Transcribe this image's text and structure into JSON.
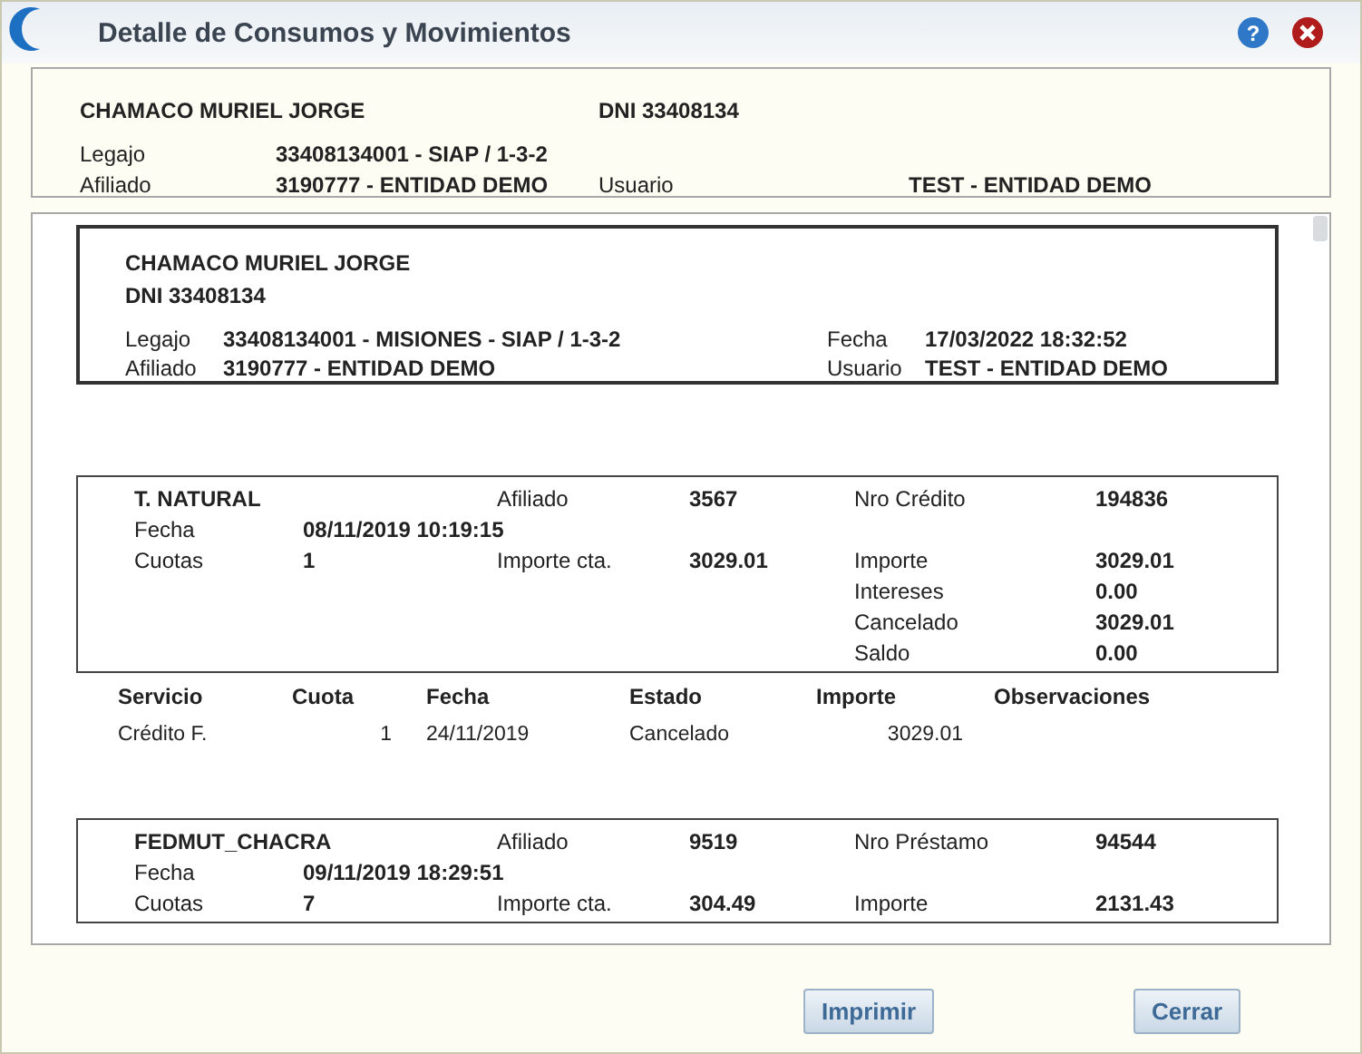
{
  "window": {
    "title": "Detalle de Consumos y Movimientos",
    "help": "?"
  },
  "header": {
    "name": "CHAMACO MURIEL JORGE",
    "dni": "DNI  33408134",
    "legajo": {
      "label": "Legajo",
      "value": "33408134001  -  SIAP / 1-3-2"
    },
    "afiliado": {
      "label": "Afiliado",
      "value": "3190777  -  ENTIDAD DEMO"
    },
    "usuario": {
      "label": "Usuario",
      "value": "TEST  -  ENTIDAD DEMO"
    }
  },
  "report": {
    "name": "CHAMACO MURIEL JORGE",
    "dni": "DNI  33408134",
    "legajo": {
      "label": "Legajo",
      "value": "33408134001  -  MISIONES - SIAP / 1-3-2"
    },
    "afiliado": {
      "label": "Afiliado",
      "value": "3190777  -  ENTIDAD DEMO"
    },
    "fecha": {
      "label": "Fecha",
      "value": "17/03/2022   18:32:52"
    },
    "usuario": {
      "label": "Usuario",
      "value": "TEST  -  ENTIDAD DEMO"
    }
  },
  "credits": [
    {
      "title": "T. NATURAL",
      "afiliado": {
        "label": "Afiliado",
        "value": "3567"
      },
      "number": {
        "label": "Nro Crédito",
        "value": "194836"
      },
      "fecha": {
        "label": "Fecha",
        "value": "08/11/2019   10:19:15"
      },
      "cuotas": {
        "label": "Cuotas",
        "value": "1"
      },
      "importe_cta": {
        "label": "Importe cta.",
        "value": "3029.01"
      },
      "totals": [
        {
          "label": "Importe",
          "value": "3029.01"
        },
        {
          "label": "Intereses",
          "value": "0.00"
        },
        {
          "label": "Cancelado",
          "value": "3029.01"
        },
        {
          "label": "Saldo",
          "value": "0.00"
        }
      ],
      "table": {
        "columns": [
          "Servicio",
          "Cuota",
          "Fecha",
          "Estado",
          "Importe",
          "Observaciones"
        ],
        "rows": [
          [
            "Crédito F.",
            "1",
            "24/11/2019",
            "Cancelado",
            "3029.01"
          ]
        ]
      }
    },
    {
      "title": "FEDMUT_CHACRA",
      "afiliado": {
        "label": "Afiliado",
        "value": "9519"
      },
      "number": {
        "label": "Nro Préstamo",
        "value": "94544"
      },
      "fecha": {
        "label": "Fecha",
        "value": "09/11/2019   18:29:51"
      },
      "cuotas": {
        "label": "Cuotas",
        "value": "7"
      },
      "importe_cta": {
        "label": "Importe cta.",
        "value": "304.49"
      },
      "totals": [
        {
          "label": "Importe",
          "value": "2131.43"
        }
      ]
    }
  ],
  "buttons": [
    "Imprimir",
    "Cerrar"
  ]
}
